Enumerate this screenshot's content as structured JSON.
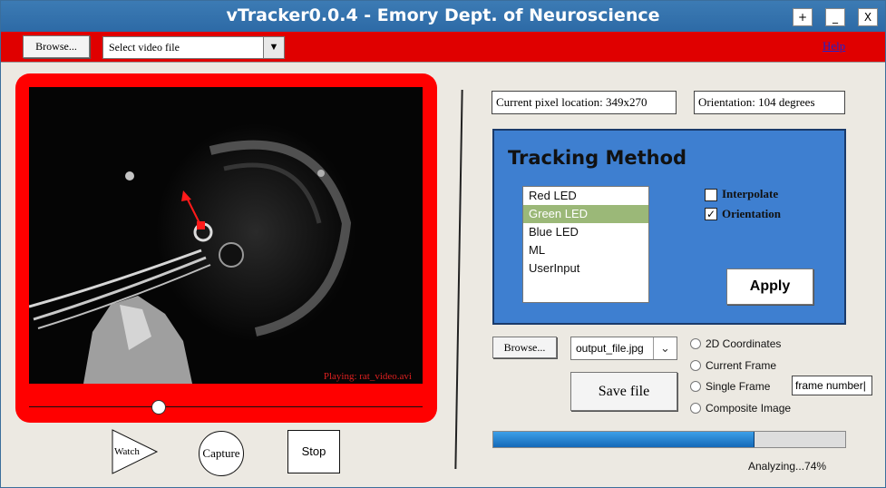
{
  "window": {
    "title": "vTracker0.0.4 - Emory Dept. of Neuroscience",
    "controls": [
      "+",
      "_",
      "X"
    ]
  },
  "menubar": {
    "browse_label": "Browse...",
    "video_select": "Select video file",
    "help_label": "Help"
  },
  "video": {
    "playing_text": "Playing: rat_video.avi",
    "progress_fraction": 0.33
  },
  "playback": {
    "watch_label": "Watch",
    "capture_label": "Capture",
    "stop_label": "Stop"
  },
  "readouts": {
    "pixel_location": "Current pixel location: 349x270",
    "orientation": "Orientation: 104 degrees"
  },
  "tracking": {
    "title": "Tracking Method",
    "methods": [
      "Red LED",
      "Green LED",
      "Blue LED",
      "ML",
      "UserInput"
    ],
    "selected": "Green LED",
    "interpolate_label": "Interpolate",
    "interpolate_checked": false,
    "orientation_label": "Orientation",
    "orientation_checked": true,
    "apply_label": "Apply"
  },
  "output": {
    "browse_label": "Browse...",
    "file_name": "output_file.jpg",
    "save_label": "Save file",
    "options": [
      "2D Coordinates",
      "Current Frame",
      "Single Frame",
      "Composite Image"
    ],
    "frame_number_value": "frame number|"
  },
  "progress": {
    "value_percent": 74,
    "status_text": "Analyzing...74%"
  },
  "colors": {
    "titlebar": "#2d6aa6",
    "menubar": "#e00000",
    "video_frame": "#ff0000",
    "panel": "#3e7fd0",
    "selection": "#9bb878",
    "progress": "#1a7ed0"
  }
}
